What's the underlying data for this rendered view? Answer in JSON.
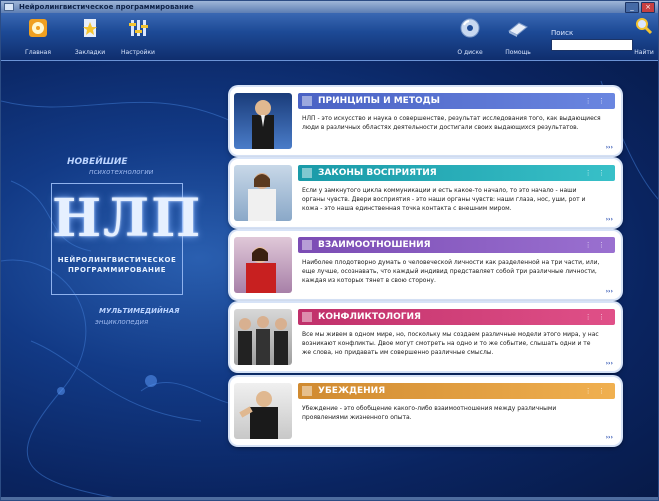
{
  "window": {
    "title": "Нейролингвистическое программирование"
  },
  "toolbar": {
    "buttons": [
      {
        "label": "Главная",
        "icon": "home-disc-icon"
      },
      {
        "label": "Закладки",
        "icon": "bookmark-star-icon"
      },
      {
        "label": "Настройки",
        "icon": "settings-icon"
      },
      {
        "label": "О диске",
        "icon": "cd-icon"
      },
      {
        "label": "Помощь",
        "icon": "help-book-icon"
      }
    ],
    "search_label": "Поиск",
    "search_value": "",
    "search_go": "Найти"
  },
  "hero": {
    "line1": "НОВЕЙШИЕ",
    "line2": "психотехнологии",
    "logo_big": "НЛП",
    "logo_sub1": "НЕЙРОЛИНГВИСТИЧЕСКОЕ",
    "logo_sub2": "ПРОГРАММИРОВАНИЕ",
    "mm1": "МУЛЬТИМЕДИЙНАЯ",
    "mm2": "энциклопедия"
  },
  "cards": [
    {
      "title": "ПРИНЦИПЫ И МЕТОДЫ",
      "color": "#4a62c4",
      "text": "НЛП - это искусство и наука о совершенстве, результат исследования того, как выдающиеся люди в различных областях деятельности достигали своих выдающихся результатов.",
      "more": "›››"
    },
    {
      "title": "ЗАКОНЫ ВОСПРИЯТИЯ",
      "color": "#1a9aa8",
      "text": "Если у замкнутого цикла коммуникации и есть какое-то начало, то это начало - наши органы чувств. Двери восприятия - это наши органы чувств: наши глаза, нос, уши, рот и кожа - это наша единственная точка контакта с внешним миром.",
      "more": "›››"
    },
    {
      "title": "ВЗАИМООТНОШЕНИЯ",
      "color": "#7b4cb4",
      "text": "Наиболее плодотворно думать о человеческой личности как разделенной на три части, или, еще лучше, осознавать, что каждый индивид представляет собой три различные личности, каждая из которых тянет в свою сторону.",
      "more": "›››"
    },
    {
      "title": "КОНФЛИКТОЛОГИЯ",
      "color": "#c0306a",
      "text": "Все мы живем в одном мире, но, поскольку мы создаем различные модели этого мира, у нас возникают конфликты. Двое могут смотреть на одно и то же событие, слышать одни и те же слова, но придавать им совершенно различные смыслы.",
      "more": "›››"
    },
    {
      "title": "УБЕЖДЕНИЯ",
      "color": "#d08a30",
      "text": "Убеждение - это обобщение какого-либо взаимоотношения между различными проявлениями жизненного опыта.",
      "more": "›››"
    }
  ]
}
